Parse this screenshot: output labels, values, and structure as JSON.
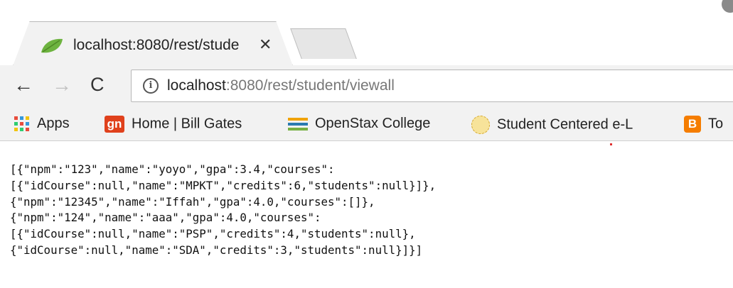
{
  "tab": {
    "title": "localhost:8080/rest/stude",
    "close": "✕"
  },
  "toolbar": {
    "back": "←",
    "forward": "→",
    "reload": "C",
    "info": "i",
    "url_host": "localhost",
    "url_rest": ":8080/rest/student/viewall"
  },
  "bookmarks": [
    {
      "label": "Apps",
      "icon": "apps-grid-icon"
    },
    {
      "label": "Home | Bill Gates",
      "icon": "gn-icon",
      "icon_text": "gn"
    },
    {
      "label": "OpenStax College",
      "icon": "openstax-icon"
    },
    {
      "label": "Student Centered e-L",
      "icon": "student-centered-icon"
    },
    {
      "label": "To",
      "icon": "blogger-icon",
      "icon_text": "B"
    }
  ],
  "colors": {
    "chrome_bg": "#f2f2f2",
    "gn_brand": "#e0411c",
    "blogger_brand": "#f57d00",
    "favicon_green": "#6db33f"
  },
  "content": {
    "lines": [
      "[{\"npm\":\"123\",\"name\":\"yoyo\",\"gpa\":3.4,\"courses\":",
      "[{\"idCourse\":null,\"name\":\"MPKT\",\"credits\":6,\"students\":null}]},",
      "{\"npm\":\"12345\",\"name\":\"Iffah\",\"gpa\":4.0,\"courses\":[]},",
      "{\"npm\":\"124\",\"name\":\"aaa\",\"gpa\":4.0,\"courses\":",
      "[{\"idCourse\":null,\"name\":\"PSP\",\"credits\":4,\"students\":null},",
      "{\"idCourse\":null,\"name\":\"SDA\",\"credits\":3,\"students\":null}]}]"
    ]
  }
}
